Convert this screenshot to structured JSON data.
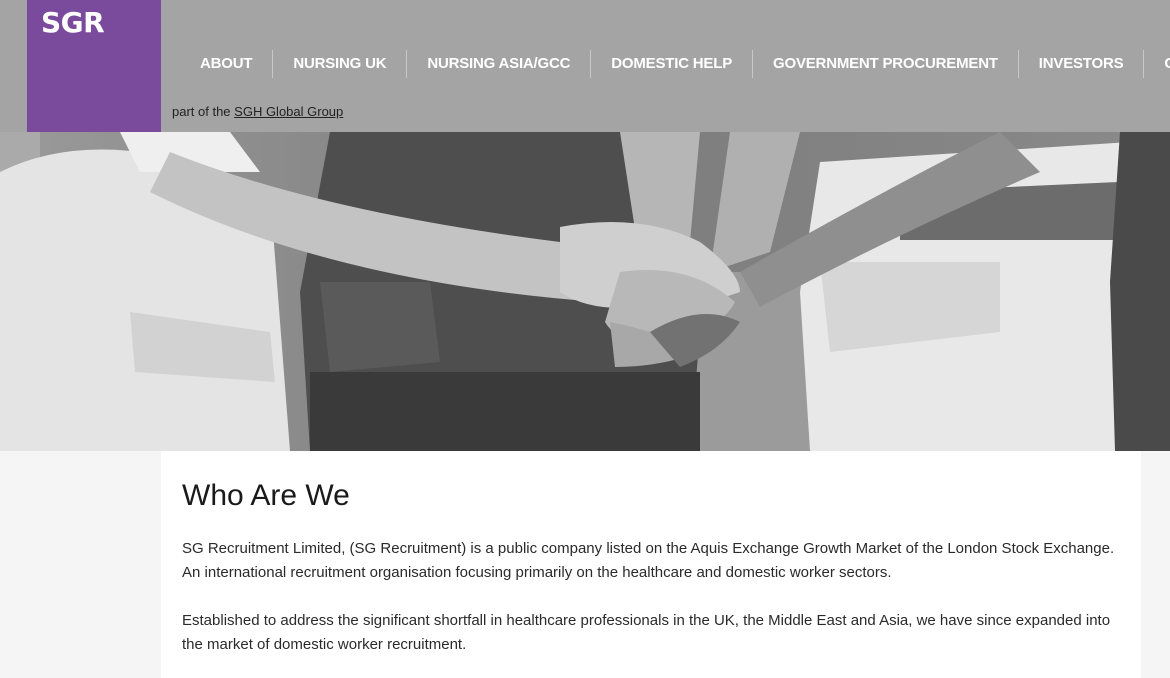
{
  "logo": {
    "text": "SGR"
  },
  "nav": {
    "items": [
      {
        "label": "ABOUT"
      },
      {
        "label": "NURSING UK"
      },
      {
        "label": "NURSING ASIA/GCC"
      },
      {
        "label": "DOMESTIC HELP"
      },
      {
        "label": "GOVERNMENT PROCUREMENT"
      },
      {
        "label": "INVESTORS"
      },
      {
        "label": "CON"
      }
    ]
  },
  "tagline": {
    "prefix": "part of the ",
    "link": "SGH Global Group"
  },
  "hero": {
    "icon": "hands-together-photo"
  },
  "content": {
    "title": "Who Are We",
    "paragraphs": [
      "SG Recruitment Limited, (SG Recruitment) is a public company listed on the Aquis Exchange Growth Market of the London Stock Exchange. An international recruitment organisation focusing primarily on the healthcare and domestic worker sectors.",
      "Established to address the significant shortfall in healthcare professionals in the UK, the Middle East and Asia, we have since expanded into the market of domestic worker recruitment."
    ]
  },
  "colors": {
    "brand": "#7a4a9c",
    "header_bg": "#a5a4a5"
  }
}
